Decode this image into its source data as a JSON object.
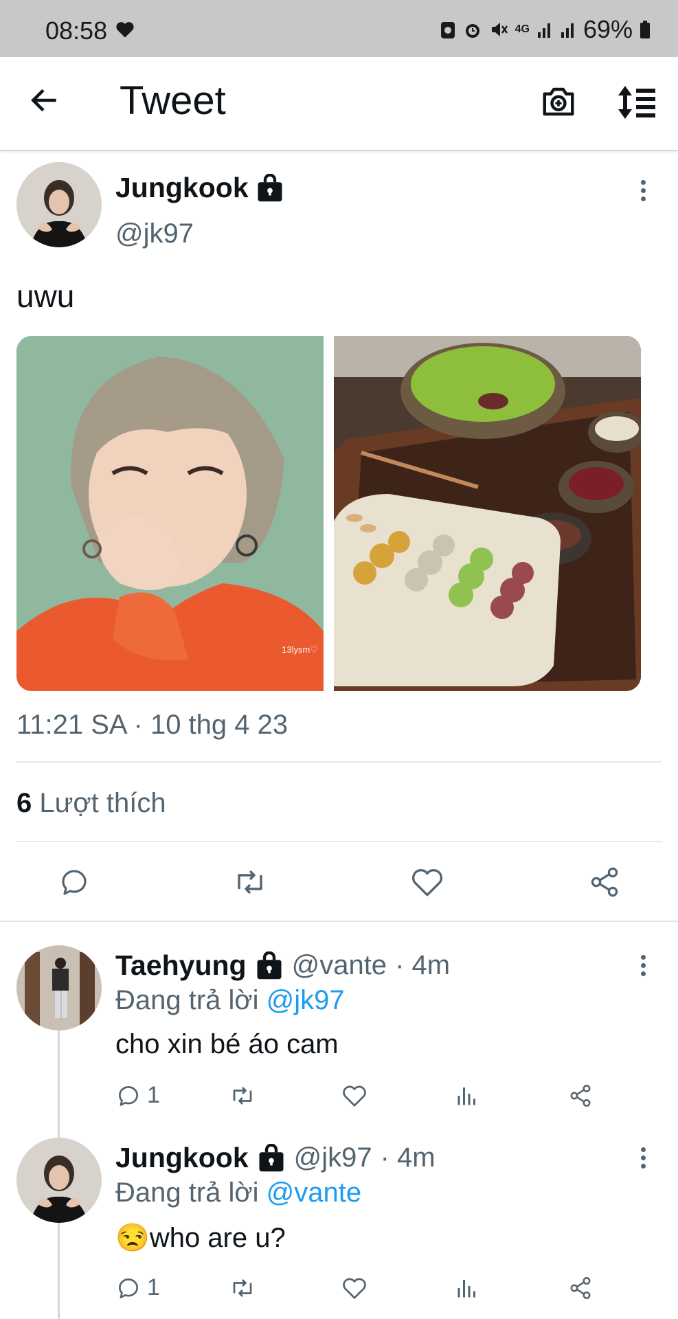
{
  "status_bar": {
    "time": "08:58",
    "battery": "69%",
    "network": "4G"
  },
  "header": {
    "title": "Tweet"
  },
  "tweet": {
    "author_name": "Jungkook",
    "author_handle": "@jk97",
    "text": "uwu",
    "image1_watermark": "13lysm♡",
    "timestamp": "11:21 SA · 10 thg 4 23",
    "likes_count": "6",
    "likes_label": "Lượt thích"
  },
  "replies": [
    {
      "author_name": "Taehyung",
      "author_handle": "@vante",
      "time": "· 4m",
      "replying_prefix": "Đang trả lời",
      "replying_to": "@jk97",
      "text": "cho xin bé áo cam",
      "reply_count": "1"
    },
    {
      "author_name": "Jungkook",
      "author_handle": "@jk97",
      "time": "· 4m",
      "replying_prefix": "Đang trả lời",
      "replying_to": "@vante",
      "emoji": "😒",
      "text": "who are u?",
      "reply_count": "1"
    }
  ],
  "colors": {
    "accent": "#1d9bf0",
    "text": "#0f1419",
    "muted": "#536471",
    "statusbar": "#c8c8c8"
  }
}
